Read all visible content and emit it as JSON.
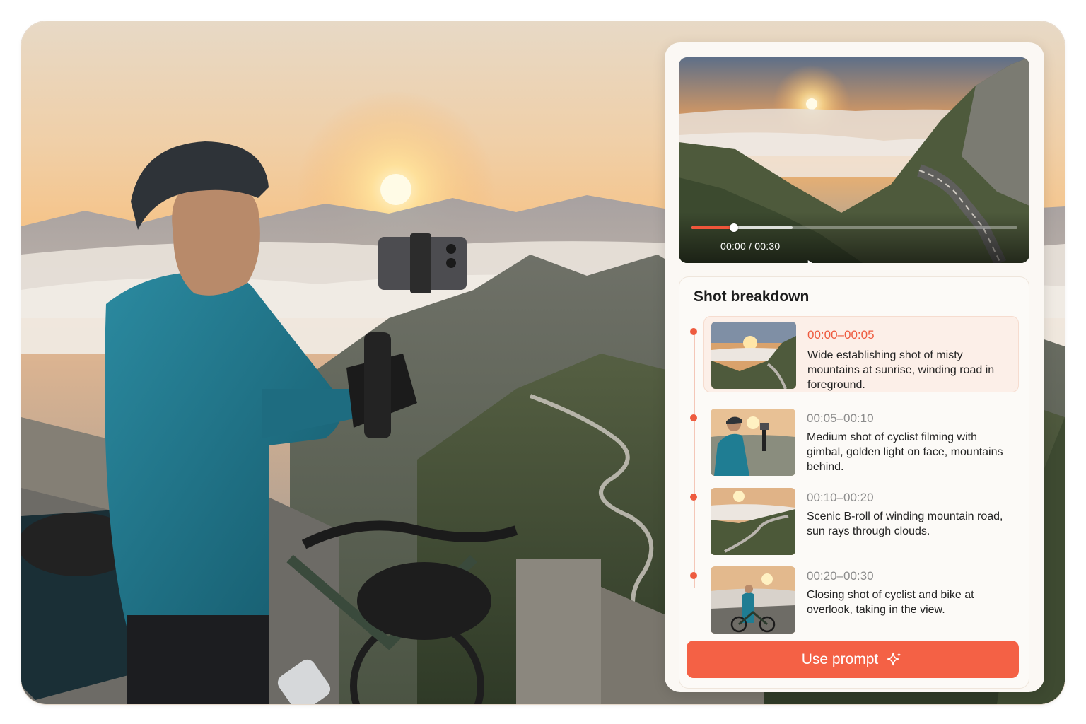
{
  "player": {
    "time": "00:00 / 00:30",
    "progress": 0.0,
    "played_fraction": 0.13,
    "buffered_fraction": 0.31
  },
  "breakdown": {
    "title": "Shot breakdown",
    "shots": [
      {
        "time": "00:00–00:05",
        "description": "Wide establishing shot of misty mountains at sunrise, winding road in foreground.",
        "active": true
      },
      {
        "time": "00:05–00:10",
        "description": "Medium shot of cyclist filming with gimbal, golden light on face, mountains behind.",
        "active": false
      },
      {
        "time": "00:10–00:20",
        "description": "Scenic B-roll of winding mountain road, sun rays through clouds.",
        "active": false
      },
      {
        "time": "00:20–00:30",
        "description": "Closing shot of cyclist and bike at overlook, taking in the view.",
        "active": false
      }
    ]
  },
  "cta": {
    "label": "Use prompt",
    "icon": "sparkle-icon"
  },
  "colors": {
    "accent": "#f46145",
    "active_time": "#ee5b3f",
    "panel": "#fbf8f4"
  }
}
